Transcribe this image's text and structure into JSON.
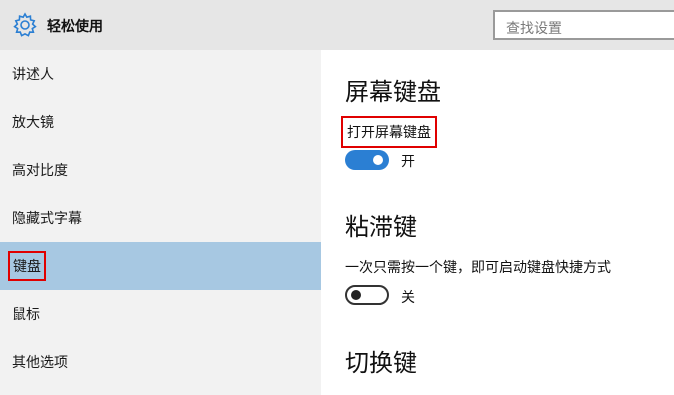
{
  "header": {
    "title": "轻松使用",
    "search_placeholder": "查找设置",
    "icon": "gear-icon"
  },
  "sidebar": {
    "items": [
      {
        "label": "讲述人"
      },
      {
        "label": "放大镜"
      },
      {
        "label": "高对比度"
      },
      {
        "label": "隐藏式字幕"
      },
      {
        "label": "键盘",
        "selected": true
      },
      {
        "label": "鼠标"
      },
      {
        "label": "其他选项"
      }
    ]
  },
  "main": {
    "onscreen_keyboard": {
      "heading": "屏幕键盘",
      "setting_label": "打开屏幕键盘",
      "toggle_state": "开",
      "toggle_on": true
    },
    "sticky_keys": {
      "heading": "粘滞键",
      "setting_label": "一次只需按一个键，即可启动键盘快捷方式",
      "toggle_state": "关",
      "toggle_on": false
    },
    "toggle_keys": {
      "heading": "切换键"
    }
  },
  "colors": {
    "accent": "#2b7fd3",
    "selected_nav": "#a7c8e2",
    "highlight_box": "#e00000"
  }
}
